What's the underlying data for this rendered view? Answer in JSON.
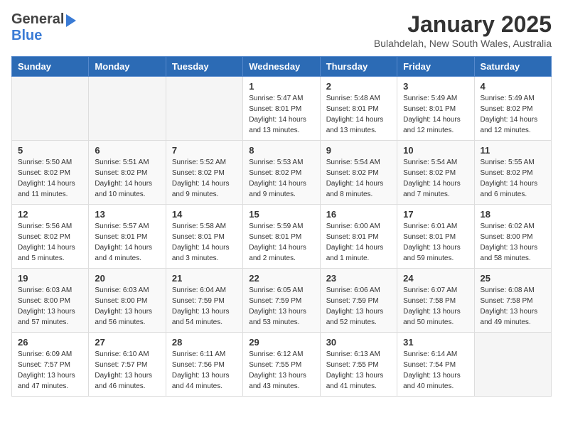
{
  "header": {
    "logo_general": "General",
    "logo_blue": "Blue",
    "month": "January 2025",
    "location": "Bulahdelah, New South Wales, Australia"
  },
  "days_of_week": [
    "Sunday",
    "Monday",
    "Tuesday",
    "Wednesday",
    "Thursday",
    "Friday",
    "Saturday"
  ],
  "weeks": [
    [
      {
        "day": "",
        "info": ""
      },
      {
        "day": "",
        "info": ""
      },
      {
        "day": "",
        "info": ""
      },
      {
        "day": "1",
        "info": "Sunrise: 5:47 AM\nSunset: 8:01 PM\nDaylight: 14 hours\nand 13 minutes."
      },
      {
        "day": "2",
        "info": "Sunrise: 5:48 AM\nSunset: 8:01 PM\nDaylight: 14 hours\nand 13 minutes."
      },
      {
        "day": "3",
        "info": "Sunrise: 5:49 AM\nSunset: 8:01 PM\nDaylight: 14 hours\nand 12 minutes."
      },
      {
        "day": "4",
        "info": "Sunrise: 5:49 AM\nSunset: 8:02 PM\nDaylight: 14 hours\nand 12 minutes."
      }
    ],
    [
      {
        "day": "5",
        "info": "Sunrise: 5:50 AM\nSunset: 8:02 PM\nDaylight: 14 hours\nand 11 minutes."
      },
      {
        "day": "6",
        "info": "Sunrise: 5:51 AM\nSunset: 8:02 PM\nDaylight: 14 hours\nand 10 minutes."
      },
      {
        "day": "7",
        "info": "Sunrise: 5:52 AM\nSunset: 8:02 PM\nDaylight: 14 hours\nand 9 minutes."
      },
      {
        "day": "8",
        "info": "Sunrise: 5:53 AM\nSunset: 8:02 PM\nDaylight: 14 hours\nand 9 minutes."
      },
      {
        "day": "9",
        "info": "Sunrise: 5:54 AM\nSunset: 8:02 PM\nDaylight: 14 hours\nand 8 minutes."
      },
      {
        "day": "10",
        "info": "Sunrise: 5:54 AM\nSunset: 8:02 PM\nDaylight: 14 hours\nand 7 minutes."
      },
      {
        "day": "11",
        "info": "Sunrise: 5:55 AM\nSunset: 8:02 PM\nDaylight: 14 hours\nand 6 minutes."
      }
    ],
    [
      {
        "day": "12",
        "info": "Sunrise: 5:56 AM\nSunset: 8:02 PM\nDaylight: 14 hours\nand 5 minutes."
      },
      {
        "day": "13",
        "info": "Sunrise: 5:57 AM\nSunset: 8:01 PM\nDaylight: 14 hours\nand 4 minutes."
      },
      {
        "day": "14",
        "info": "Sunrise: 5:58 AM\nSunset: 8:01 PM\nDaylight: 14 hours\nand 3 minutes."
      },
      {
        "day": "15",
        "info": "Sunrise: 5:59 AM\nSunset: 8:01 PM\nDaylight: 14 hours\nand 2 minutes."
      },
      {
        "day": "16",
        "info": "Sunrise: 6:00 AM\nSunset: 8:01 PM\nDaylight: 14 hours\nand 1 minute."
      },
      {
        "day": "17",
        "info": "Sunrise: 6:01 AM\nSunset: 8:01 PM\nDaylight: 13 hours\nand 59 minutes."
      },
      {
        "day": "18",
        "info": "Sunrise: 6:02 AM\nSunset: 8:00 PM\nDaylight: 13 hours\nand 58 minutes."
      }
    ],
    [
      {
        "day": "19",
        "info": "Sunrise: 6:03 AM\nSunset: 8:00 PM\nDaylight: 13 hours\nand 57 minutes."
      },
      {
        "day": "20",
        "info": "Sunrise: 6:03 AM\nSunset: 8:00 PM\nDaylight: 13 hours\nand 56 minutes."
      },
      {
        "day": "21",
        "info": "Sunrise: 6:04 AM\nSunset: 7:59 PM\nDaylight: 13 hours\nand 54 minutes."
      },
      {
        "day": "22",
        "info": "Sunrise: 6:05 AM\nSunset: 7:59 PM\nDaylight: 13 hours\nand 53 minutes."
      },
      {
        "day": "23",
        "info": "Sunrise: 6:06 AM\nSunset: 7:59 PM\nDaylight: 13 hours\nand 52 minutes."
      },
      {
        "day": "24",
        "info": "Sunrise: 6:07 AM\nSunset: 7:58 PM\nDaylight: 13 hours\nand 50 minutes."
      },
      {
        "day": "25",
        "info": "Sunrise: 6:08 AM\nSunset: 7:58 PM\nDaylight: 13 hours\nand 49 minutes."
      }
    ],
    [
      {
        "day": "26",
        "info": "Sunrise: 6:09 AM\nSunset: 7:57 PM\nDaylight: 13 hours\nand 47 minutes."
      },
      {
        "day": "27",
        "info": "Sunrise: 6:10 AM\nSunset: 7:57 PM\nDaylight: 13 hours\nand 46 minutes."
      },
      {
        "day": "28",
        "info": "Sunrise: 6:11 AM\nSunset: 7:56 PM\nDaylight: 13 hours\nand 44 minutes."
      },
      {
        "day": "29",
        "info": "Sunrise: 6:12 AM\nSunset: 7:55 PM\nDaylight: 13 hours\nand 43 minutes."
      },
      {
        "day": "30",
        "info": "Sunrise: 6:13 AM\nSunset: 7:55 PM\nDaylight: 13 hours\nand 41 minutes."
      },
      {
        "day": "31",
        "info": "Sunrise: 6:14 AM\nSunset: 7:54 PM\nDaylight: 13 hours\nand 40 minutes."
      },
      {
        "day": "",
        "info": ""
      }
    ]
  ]
}
